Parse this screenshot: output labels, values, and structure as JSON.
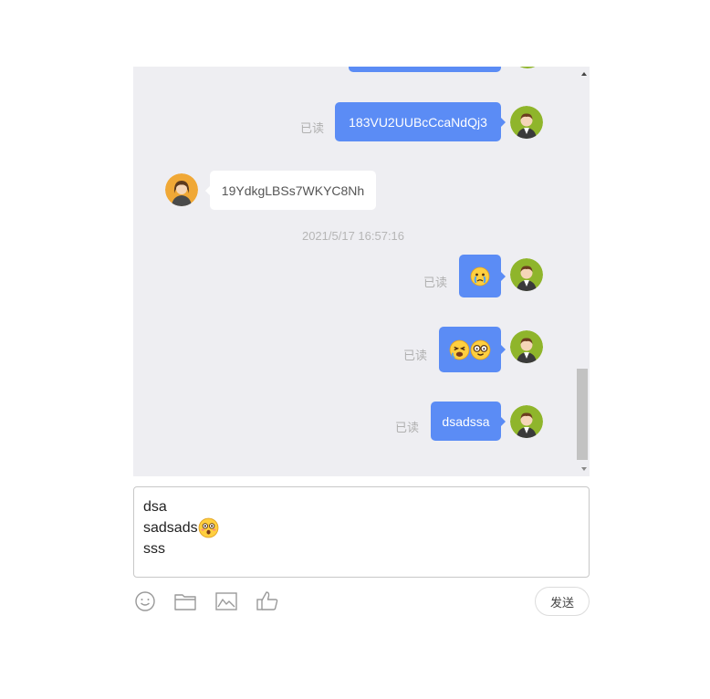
{
  "colors": {
    "panel_bg": "#eeeef2",
    "my_bubble": "#5b8cf5",
    "their_bubble": "#ffffff",
    "read_text": "#b0b0b0",
    "my_avatar_bg": "#8fb52b",
    "their_avatar_bg": "#f0a836"
  },
  "messages": [
    {
      "from": "me",
      "type": "text",
      "text": "183VU2UUBcCcaNdQj3",
      "status": "已读",
      "avatar": "male-avatar-icon"
    },
    {
      "from": "other",
      "type": "text",
      "text": "19YdkgLBSs7WKYC8Nh",
      "avatar": "female-avatar-icon"
    },
    {
      "type": "timestamp",
      "text": "2021/5/17 16:57:16"
    },
    {
      "from": "me",
      "type": "emoji",
      "emojis": [
        "crying-face-emoji"
      ],
      "status": "已读",
      "avatar": "male-avatar-icon"
    },
    {
      "from": "me",
      "type": "emoji",
      "emojis": [
        "tired-face-emoji",
        "nerd-face-emoji"
      ],
      "status": "已读",
      "avatar": "male-avatar-icon"
    },
    {
      "from": "me",
      "type": "text",
      "text": "dsadssa",
      "status": "已读",
      "avatar": "male-avatar-icon"
    }
  ],
  "composer": {
    "lines": [
      "dsa",
      "sadsads",
      "sss"
    ],
    "inline_emoji": "flushed-face-emoji"
  },
  "toolbar": {
    "icons": [
      "smiley-icon",
      "folder-icon",
      "image-icon",
      "thumbs-up-icon"
    ],
    "send_label": "发送"
  }
}
